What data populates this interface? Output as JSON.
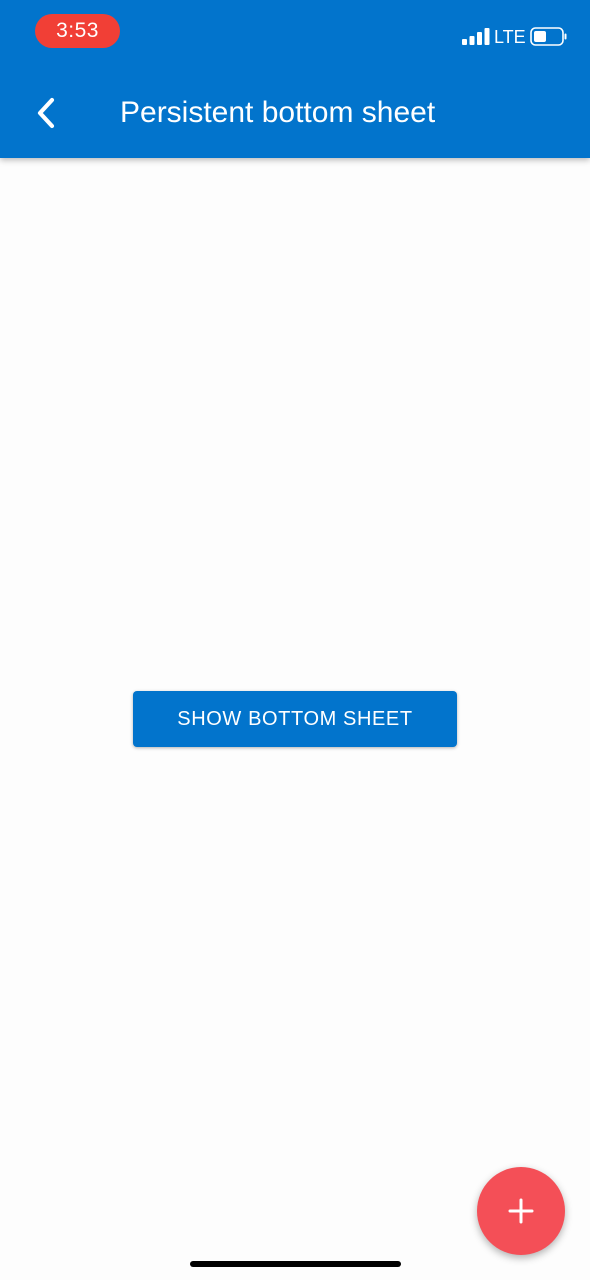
{
  "status_bar": {
    "time": "3:53",
    "network": "LTE",
    "signal_icon": "cellular-signal-icon",
    "battery_icon": "battery-icon",
    "time_pill_color": "#f13f36"
  },
  "app_bar": {
    "title": "Persistent bottom sheet",
    "back_icon": "chevron-left-icon",
    "color": "#0274cc"
  },
  "main": {
    "show_sheet_label": "SHOW BOTTOM SHEET"
  },
  "fab": {
    "icon": "plus-icon",
    "color": "#f44f57"
  }
}
